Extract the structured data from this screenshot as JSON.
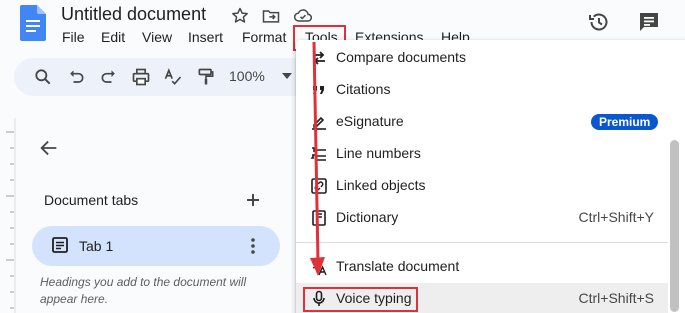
{
  "header": {
    "doc_title": "Untitled document",
    "menus": [
      "File",
      "Edit",
      "View",
      "Insert",
      "Format",
      "Tools",
      "Extensions",
      "Help"
    ]
  },
  "toolbar": {
    "zoom": "100%"
  },
  "sidebar": {
    "title": "Document tabs",
    "tab_label": "Tab 1",
    "hint": "Headings you add to the document will appear here."
  },
  "dropdown": {
    "items": [
      {
        "label": "Compare documents",
        "shortcut": "",
        "icon": "compare-icon"
      },
      {
        "label": "Citations",
        "shortcut": "",
        "icon": "quote-icon"
      },
      {
        "label": "eSignature",
        "shortcut": "",
        "icon": "signature-icon",
        "badge": "Premium"
      },
      {
        "label": "Line numbers",
        "shortcut": "",
        "icon": "line-numbers-icon"
      },
      {
        "label": "Linked objects",
        "shortcut": "",
        "icon": "linked-objects-icon"
      },
      {
        "label": "Dictionary",
        "shortcut": "Ctrl+Shift+Y",
        "icon": "dictionary-icon"
      },
      {
        "label": "Translate document",
        "shortcut": "",
        "icon": "translate-icon"
      },
      {
        "label": "Voice typing",
        "shortcut": "Ctrl+Shift+S",
        "icon": "microphone-icon"
      }
    ]
  },
  "colors": {
    "highlight_red": "#e0303a",
    "accent_blue": "#0b57d0",
    "tab_chip": "#d3e3fd"
  }
}
